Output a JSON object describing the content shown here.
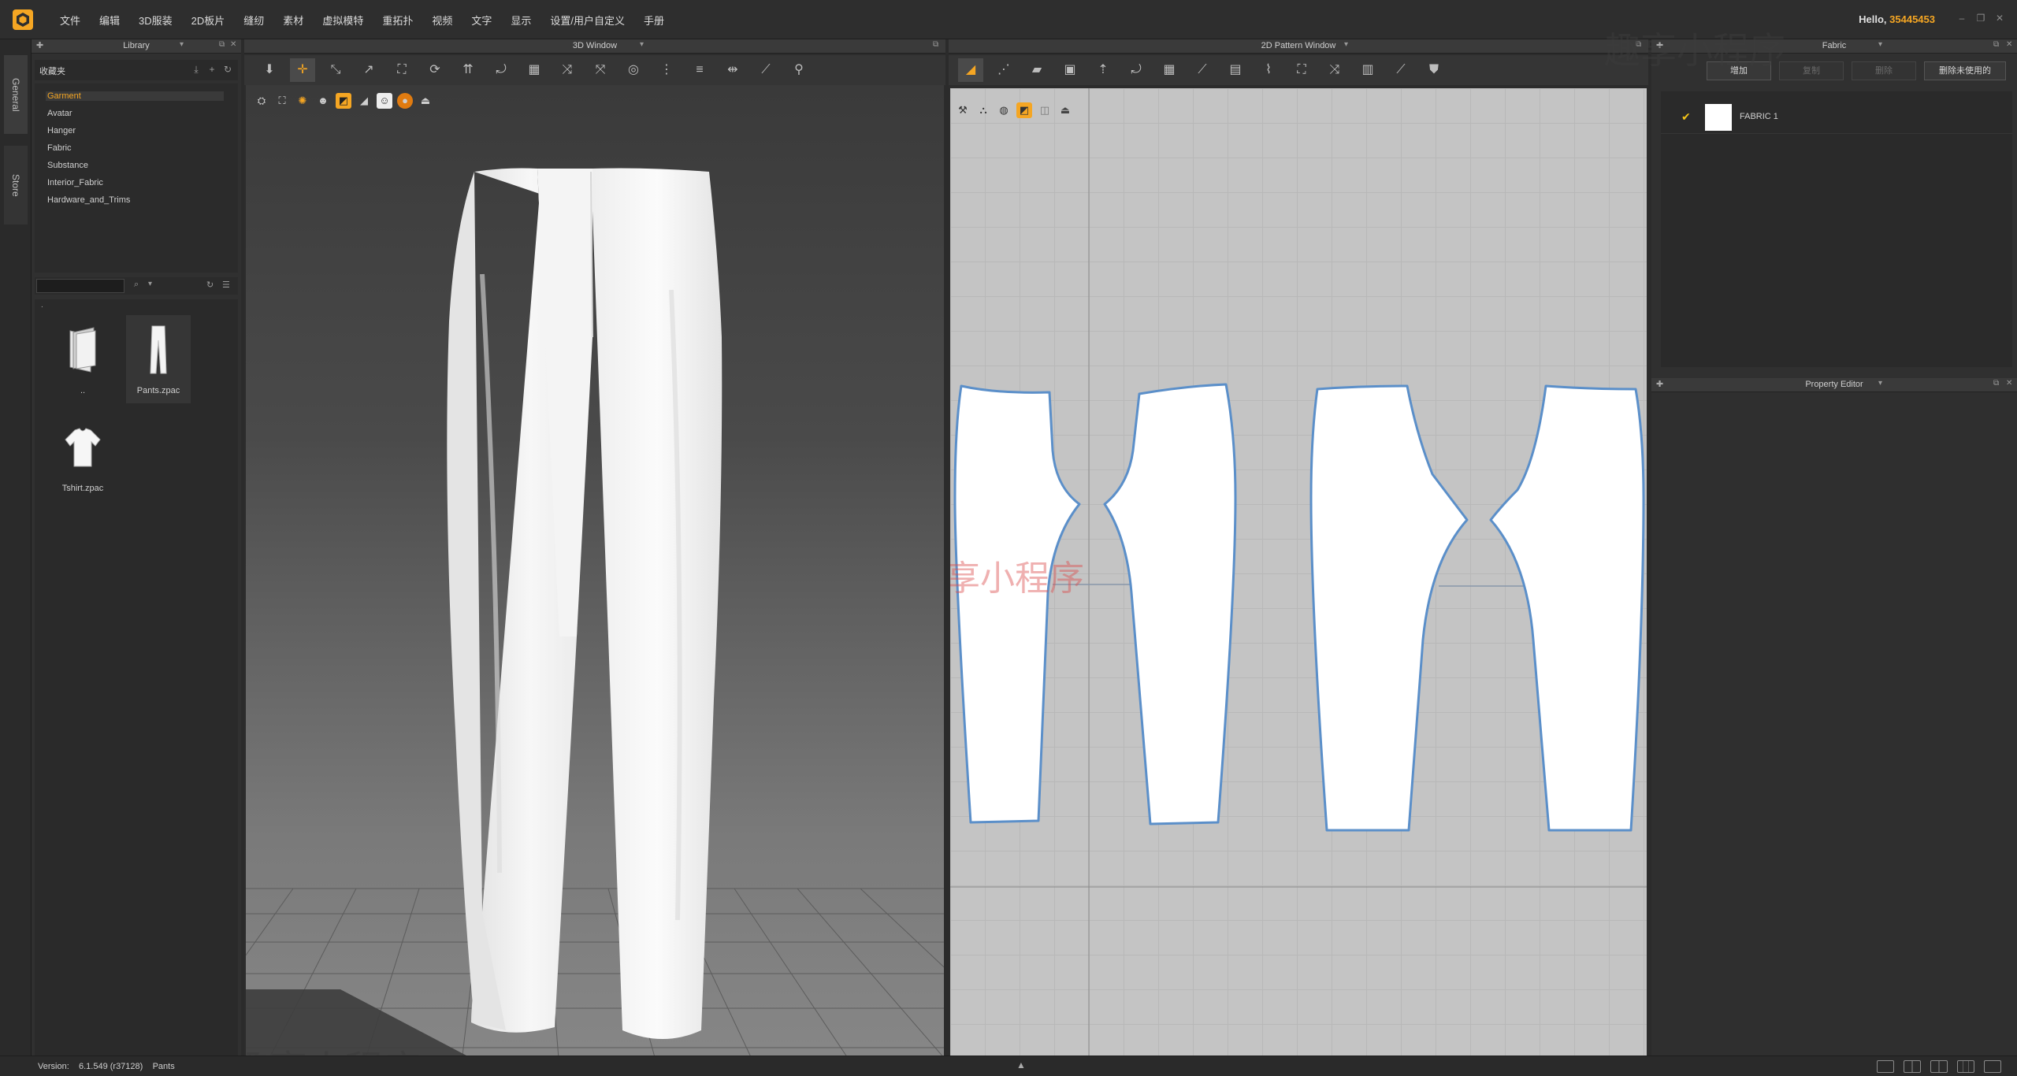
{
  "menu": {
    "items": [
      "文件",
      "编辑",
      "3D服装",
      "2D板片",
      "缝纫",
      "素材",
      "虚拟模特",
      "重拓扑",
      "视频",
      "文字",
      "显示",
      "设置/用户自定义",
      "手册"
    ],
    "hello_prefix": "Hello, ",
    "user_id": "35445453"
  },
  "side_tabs": [
    "General",
    "Store"
  ],
  "library": {
    "title": "Library",
    "favorites_label": "收藏夹",
    "tree": [
      "Garment",
      "Avatar",
      "Hanger",
      "Fabric",
      "Substance",
      "Interior_Fabric",
      "Hardware_and_Trims"
    ],
    "active_item": "Garment",
    "search_placeholder": "",
    "parent_label": "..",
    "files": [
      {
        "name": "..",
        "icon": "folder-up-icon"
      },
      {
        "name": "Pants.zpac",
        "icon": "pants-icon"
      },
      {
        "name": "Tshirt.zpac",
        "icon": "tshirt-icon"
      }
    ],
    "breadcrumb": "."
  },
  "window3d": {
    "title": "3D Window"
  },
  "window2d": {
    "title": "2D Pattern Window"
  },
  "fabric": {
    "title": "Fabric",
    "buttons": [
      "增加",
      "复制",
      "删除",
      "删除未使用的"
    ],
    "items": [
      {
        "name": "FABRIC 1",
        "color": "#ffffff",
        "checked": true
      }
    ]
  },
  "property_editor": {
    "title": "Property Editor"
  },
  "status": {
    "version_label": "Version:",
    "version": "6.1.549 (r37128)",
    "garment": "Pants"
  },
  "watermark": "趣享小程序",
  "colors": {
    "accent": "#f5a623",
    "pattern_outline": "#5b8fc9",
    "background": "#2b2b2b"
  }
}
